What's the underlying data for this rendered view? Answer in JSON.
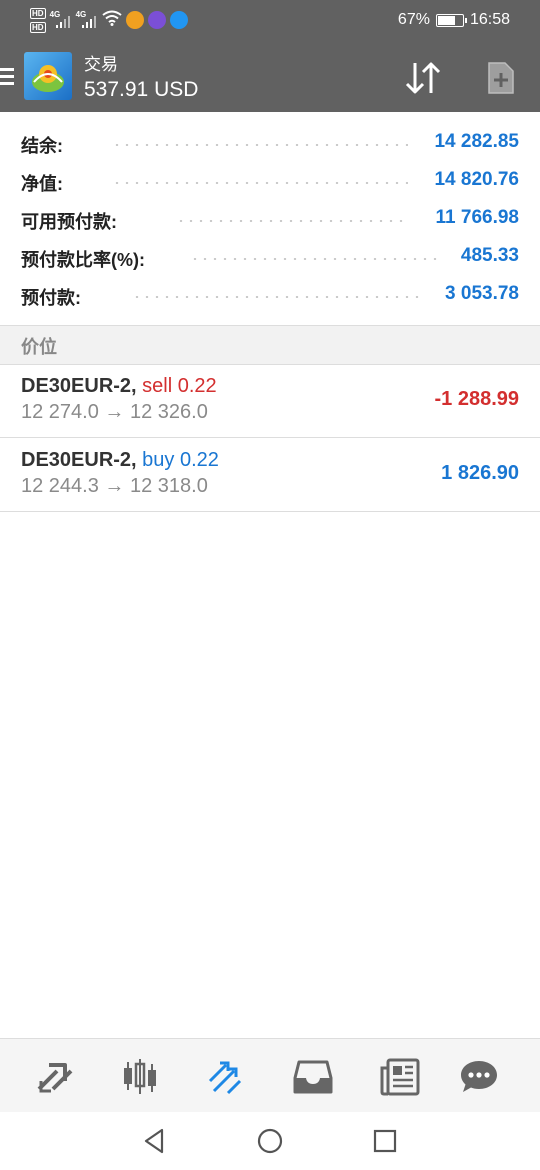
{
  "status_bar": {
    "hd_labels": [
      "HD",
      "HD"
    ],
    "network_1": "4G",
    "network_2": "4G",
    "battery_percent": "67%",
    "battery_level": 0.67,
    "time": "16:58",
    "icons": [
      "wifi-icon",
      "app-orange-icon",
      "app-purple-icon",
      "app-blue-icon"
    ]
  },
  "header": {
    "title": "交易",
    "amount": "537.91 USD",
    "icons": [
      "menu-icon",
      "metatrader-logo",
      "sort-arrows-icon",
      "new-order-icon"
    ]
  },
  "summary": [
    {
      "label": "结余:",
      "value": "14 282.85"
    },
    {
      "label": "净值:",
      "value": "14 820.76"
    },
    {
      "label": "可用预付款:",
      "value": "11 766.98"
    },
    {
      "label": "预付款比率(%):",
      "value": "485.33"
    },
    {
      "label": "预付款:",
      "value": "3 053.78"
    }
  ],
  "section_title": "价位",
  "positions": [
    {
      "symbol": "DE30EUR-2,",
      "side": "sell 0.22",
      "prices": "12 274.0 → 12 326.0",
      "profit": "-1 288.99"
    },
    {
      "symbol": "DE30EUR-2,",
      "side": "buy 0.22",
      "prices": "12 244.3 → 12 318.0",
      "profit": "1 826.90"
    }
  ],
  "colors": {
    "header_bg": "#616161",
    "value_blue": "#1976d2",
    "loss_red": "#d32f2f",
    "nav_active": "#1e88e5"
  },
  "bottom_nav": [
    "quotes-icon",
    "chart-icon",
    "trade-icon",
    "history-icon",
    "news-icon",
    "chat-icon"
  ],
  "system_nav": [
    "back-icon",
    "home-icon",
    "recents-icon"
  ]
}
